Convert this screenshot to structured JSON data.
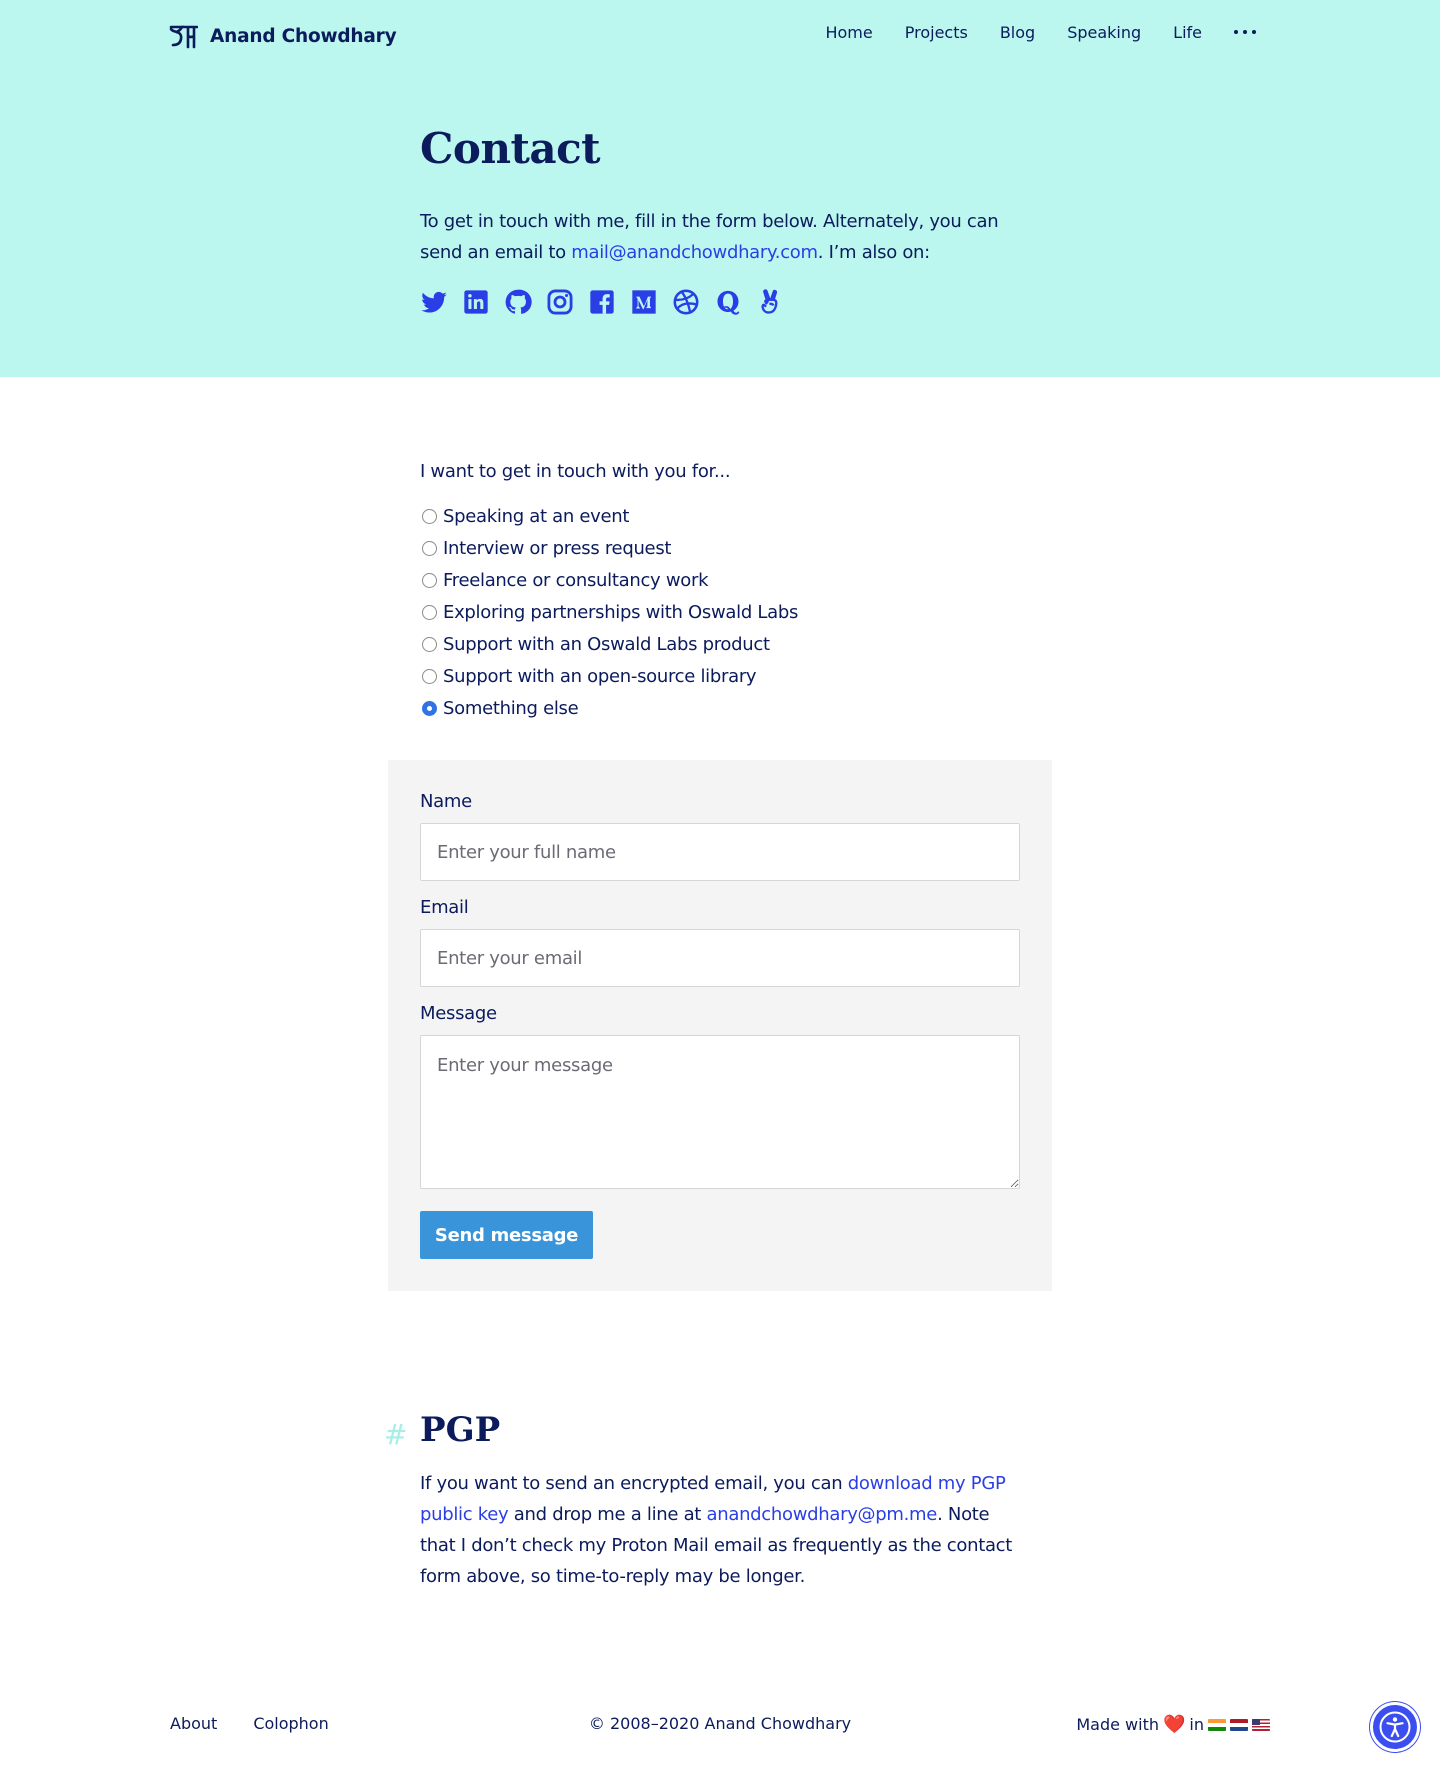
{
  "header": {
    "brand_name": "Anand Chowdhary",
    "nav": [
      {
        "label": "Home"
      },
      {
        "label": "Projects"
      },
      {
        "label": "Blog"
      },
      {
        "label": "Speaking"
      },
      {
        "label": "Life"
      }
    ],
    "more_icon": "more-dots-icon"
  },
  "hero": {
    "title": "Contact",
    "intro_before": "To get in touch with me, fill in the form below. Alternately, you can send an email to ",
    "intro_email": "mail@anandchowdhary.com",
    "intro_after": ". I’m also on:",
    "socials": [
      "twitter-icon",
      "linkedin-icon",
      "github-icon",
      "instagram-icon",
      "facebook-icon",
      "medium-icon",
      "dribbble-icon",
      "quora-icon",
      "angellist-icon"
    ]
  },
  "topic": {
    "question": "I want to get in touch with you for...",
    "options": [
      {
        "label": "Speaking at an event",
        "checked": false
      },
      {
        "label": "Interview or press request",
        "checked": false
      },
      {
        "label": "Freelance or consultancy work",
        "checked": false
      },
      {
        "label": "Exploring partnerships with Oswald Labs",
        "checked": false
      },
      {
        "label": "Support with an Oswald Labs product",
        "checked": false
      },
      {
        "label": "Support with an open-source library",
        "checked": false
      },
      {
        "label": "Something else",
        "checked": true
      }
    ]
  },
  "form": {
    "name_label": "Name",
    "name_placeholder": "Enter your full name",
    "email_label": "Email",
    "email_placeholder": "Enter your email",
    "message_label": "Message",
    "message_placeholder": "Enter your message",
    "submit_label": "Send message"
  },
  "pgp": {
    "hash": "#",
    "title": "PGP",
    "text_1": "If you want to send an encrypted email, you can ",
    "link_key": "download my PGP pub­lic key",
    "text_2": " and drop me a line at ",
    "link_email": "anandchowdhary@pm.me",
    "text_3": ". Note that I don’t check my Proton Mail email as frequently as the contact form above, so time-to-reply may be longer."
  },
  "footer": {
    "links": [
      {
        "label": "About"
      },
      {
        "label": "Colophon"
      }
    ],
    "copyright": "© 2008–2020 Anand Chowdhary",
    "made_with": "Made with",
    "heart": "❤️",
    "in": "in",
    "flags": [
      "india-flag-icon",
      "netherlands-flag-icon",
      "usa-flag-icon"
    ]
  },
  "colors": {
    "hero_bg": "#bbf7ee",
    "text": "#0b1b5c",
    "link": "#2a3ee6",
    "button": "#3a94d9",
    "card_bg": "#f4f4f4",
    "a11y": "#3b4ef0"
  },
  "a11y_widget": "accessibility-icon"
}
